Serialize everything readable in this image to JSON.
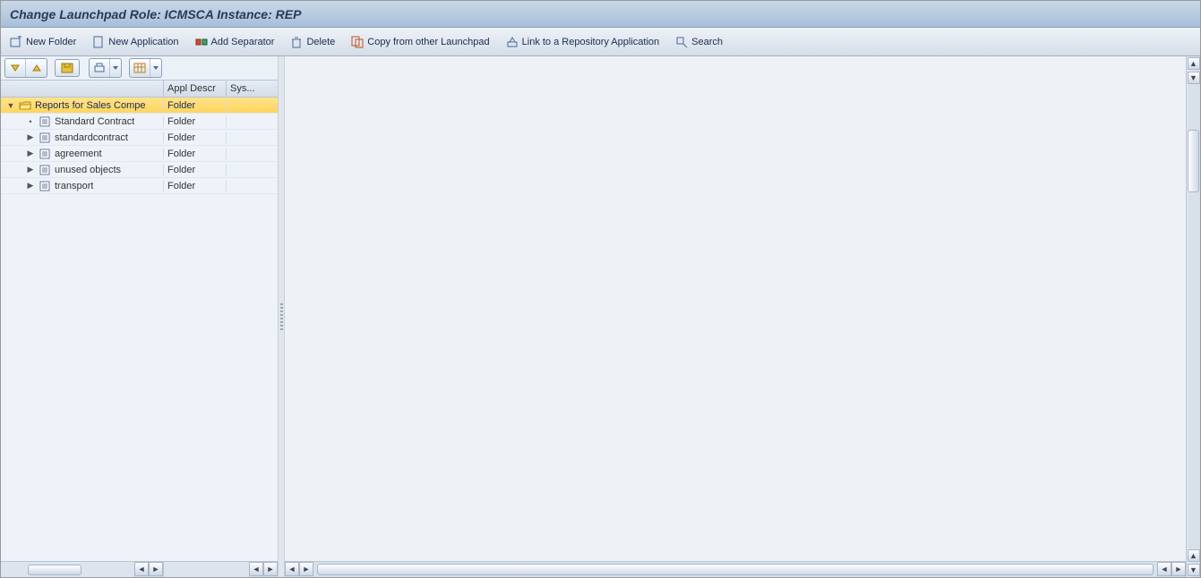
{
  "title": "Change Launchpad Role: ICMSCA Instance: REP",
  "toolbar": {
    "new_folder": "New Folder",
    "new_application": "New Application",
    "add_separator": "Add Separator",
    "delete": "Delete",
    "copy_from": "Copy from other Launchpad",
    "link_repo": "Link to a Repository Application",
    "search": "Search"
  },
  "tree_header": {
    "col1": "",
    "col2": "Appl Descr",
    "col3": "Sys..."
  },
  "tree": [
    {
      "level": 0,
      "expander": "▼",
      "icon": "folder-open",
      "label": "Reports for Sales Compe",
      "appl": "Folder",
      "sys": "",
      "selected": true
    },
    {
      "level": 1,
      "expander": "•",
      "icon": "doc",
      "label": "Standard Contract",
      "appl": "Folder",
      "sys": ""
    },
    {
      "level": 1,
      "expander": "▶",
      "icon": "doc",
      "label": "standardcontract",
      "appl": "Folder",
      "sys": ""
    },
    {
      "level": 1,
      "expander": "▶",
      "icon": "doc",
      "label": "agreement",
      "appl": "Folder",
      "sys": ""
    },
    {
      "level": 1,
      "expander": "▶",
      "icon": "doc",
      "label": "unused objects",
      "appl": "Folder",
      "sys": ""
    },
    {
      "level": 1,
      "expander": "▶",
      "icon": "doc",
      "label": "transport",
      "appl": "Folder",
      "sys": ""
    }
  ]
}
